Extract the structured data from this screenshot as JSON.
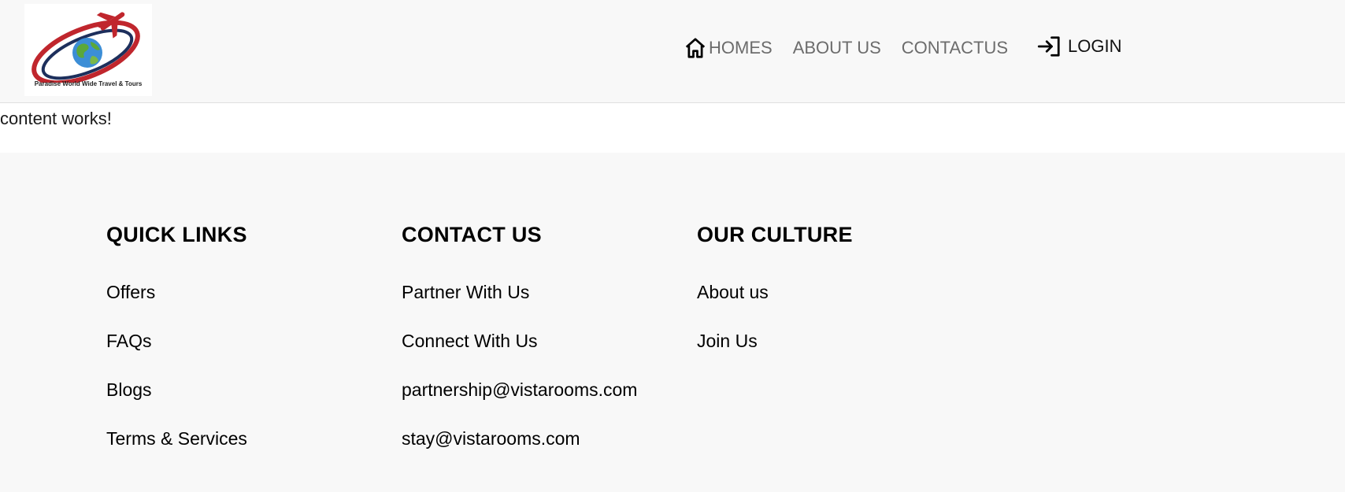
{
  "brand": {
    "logo_caption": "Paradise World Wide Travel & Tours"
  },
  "nav": {
    "items": [
      {
        "label": "HOMES",
        "icon": "home-icon"
      },
      {
        "label": "ABOUT US"
      },
      {
        "label": "CONTACTUS"
      }
    ],
    "login": {
      "label": "LOGIN",
      "icon": "login-icon"
    }
  },
  "content": {
    "text": "content works!"
  },
  "footer": {
    "quick_links": {
      "heading": "QUICK LINKS",
      "items": [
        "Offers",
        "FAQs",
        "Blogs",
        "Terms & Services"
      ]
    },
    "contact_us": {
      "heading": "CONTACT US",
      "items": [
        "Partner With Us",
        "Connect With Us",
        "partnership@vistarooms.com",
        "stay@vistarooms.com"
      ]
    },
    "our_culture": {
      "heading": "OUR CULTURE",
      "items": [
        "About us",
        "Join Us"
      ]
    }
  },
  "colors": {
    "background": "#f8f8f8",
    "content_bg": "#ffffff",
    "nav_text": "#6c6c6c",
    "logo_red": "#c0262d",
    "logo_navy": "#1d2f5c"
  }
}
